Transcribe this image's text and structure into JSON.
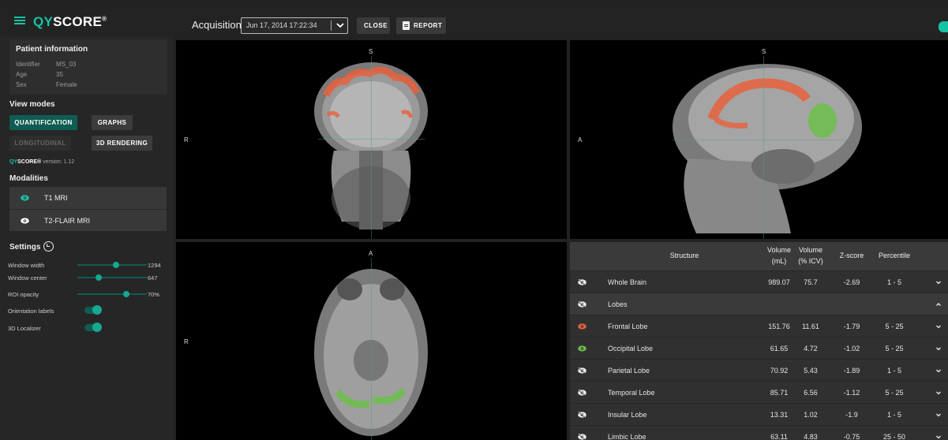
{
  "app": {
    "logo_prefix": "QY",
    "logo_main": "SCORE",
    "logo_mark": "®",
    "accent_color": "#17c3a5",
    "brand_dark": "#0f5c52"
  },
  "toolbar": {
    "acquisition_label": "Acquisition",
    "acquisition_value": "Jun 17, 2014 17:22:34",
    "close_label": "CLOSE",
    "report_label": "REPORT"
  },
  "patient": {
    "title": "Patient information",
    "rows": [
      {
        "key": "Identifier",
        "value": "MS_03"
      },
      {
        "key": "Age",
        "value": "35"
      },
      {
        "key": "Sex",
        "value": "Female"
      }
    ]
  },
  "view_modes": {
    "title": "View modes",
    "quantification": "QUANTIFICATION",
    "graphs": "GRAPHS",
    "longitudinal": "LONGITUDINAL",
    "rendering": "3D RENDERING"
  },
  "version": {
    "brand_prefix": "QY",
    "brand_main": "SCORE",
    "brand_mark": "®",
    "text": "version: 1.12"
  },
  "modalities": {
    "title": "Modalities",
    "items": [
      {
        "label": "T1 MRI",
        "icon": "eye-icon",
        "color": "#17c3a5"
      },
      {
        "label": "T2-FLAIR MRI",
        "icon": "eye-icon",
        "color": "#ffffff"
      }
    ]
  },
  "settings": {
    "title": "Settings",
    "window_width": {
      "label": "Window width",
      "value": "1294",
      "level": 0.55
    },
    "window_center": {
      "label": "Window center",
      "value": "647",
      "level": 0.3
    },
    "roi_opacity": {
      "label": "ROI opacity",
      "value": "70%",
      "level": 0.7
    },
    "orientation_labels": {
      "label": "Orientation labels",
      "on": true
    },
    "localizer": {
      "label": "3D Localizer",
      "on": true
    }
  },
  "viewers": {
    "coronal": {
      "top": "S",
      "left": "R"
    },
    "sagittal": {
      "top": "S",
      "left": "A"
    },
    "axial": {
      "top": "A",
      "left": "R"
    }
  },
  "table": {
    "headers": {
      "structure": "Structure",
      "volume_ml_1": "Volume",
      "volume_ml_2": "(mL)",
      "volume_icv_1": "Volume",
      "volume_icv_2": "(% ICV)",
      "zscore": "Z-score",
      "percentile": "Percentile"
    },
    "rows": [
      {
        "name": "Whole Brain",
        "volume": "989.07",
        "icv": "75.7",
        "z": "-2.69",
        "pct": "1 - 5",
        "eye": "hidden",
        "expand": "down",
        "group": false
      },
      {
        "name": "Lobes",
        "volume": "",
        "icv": "",
        "z": "",
        "pct": "",
        "eye": "hidden",
        "expand": "up",
        "group": true
      },
      {
        "name": "Frontal Lobe",
        "volume": "151.76",
        "icv": "11.61",
        "z": "-1.79",
        "pct": "5 - 25",
        "eye": "visible",
        "eye_color": "#e8603c",
        "expand": "down",
        "group": false
      },
      {
        "name": "Occipital Lobe",
        "volume": "61.65",
        "icv": "4.72",
        "z": "-1.02",
        "pct": "5 - 25",
        "eye": "visible",
        "eye_color": "#6cc04a",
        "expand": "down",
        "group": false
      },
      {
        "name": "Parietal Lobe",
        "volume": "70.92",
        "icv": "5.43",
        "z": "-1.89",
        "pct": "1 - 5",
        "eye": "hidden",
        "expand": "down",
        "group": false
      },
      {
        "name": "Temporal Lobe",
        "volume": "85.71",
        "icv": "6.56",
        "z": "-1.12",
        "pct": "5 - 25",
        "eye": "hidden",
        "expand": "down",
        "group": false
      },
      {
        "name": "Insular Lobe",
        "volume": "13.31",
        "icv": "1.02",
        "z": "-1.9",
        "pct": "1 - 5",
        "eye": "hidden",
        "expand": "down",
        "group": false
      },
      {
        "name": "Limbic Lobe",
        "volume": "63.11",
        "icv": "4.83",
        "z": "-0.75",
        "pct": "25 - 50",
        "eye": "hidden",
        "expand": "down",
        "group": false
      }
    ]
  }
}
